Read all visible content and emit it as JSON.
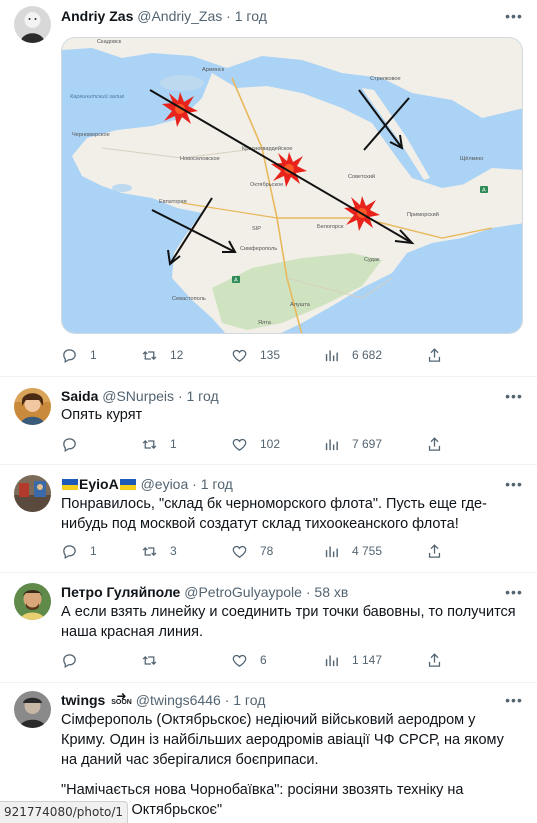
{
  "tweets": [
    {
      "name": "Andriy Zas",
      "handle": "@Andriy_Zas",
      "separator": "·",
      "time": "1 год",
      "text": "",
      "reply_count": "1",
      "retweet_count": "12",
      "like_count": "135",
      "view_count": "6 682"
    },
    {
      "name": "Saida",
      "handle": "@SNurpeis",
      "separator": "·",
      "time": "1 год",
      "text": "Опять курят",
      "reply_count": "",
      "retweet_count": "1",
      "like_count": "102",
      "view_count": "7 697"
    },
    {
      "name": "EyioA",
      "handle": "@eyioa",
      "separator": "·",
      "time": "1 год",
      "text": "Понравилось, \"склад бк черноморского флота\". Пусть еще где-нибудь под москвой создатут склад тихоокеанского флота!",
      "reply_count": "1",
      "retweet_count": "3",
      "like_count": "78",
      "view_count": "4 755"
    },
    {
      "name": "Петро Гуляйполе",
      "handle": "@PetroGulyaypole",
      "separator": "·",
      "time": "58 хв",
      "text": "А если взять линейку и соединить три точки бавовны, то получится наша красная линия.",
      "reply_count": "",
      "retweet_count": "",
      "like_count": "6",
      "view_count": "1 147"
    },
    {
      "name": "twings",
      "handle": "@twings6446",
      "separator": "·",
      "time": "1 год",
      "name_badge": "SOON",
      "text": "Сімферополь (Октябрьскоє) недіючий військовий аеродром у Криму. Один із найбільших аеродромів авіації ЧФ СРСР, на якому на даний час зберігалися боєприпаси.",
      "text2": "\"Намічається нова Чорнобаївка\": росіяни звозять техніку на аеродром Октябрьскоє\""
    }
  ],
  "map": {
    "labels": {
      "skadovsk": "Скадовск",
      "armyansk": "Армянск",
      "strelkovoe": "Стрелковое",
      "karkinit": "Каркинитский залив",
      "chernomorskoe": "Черноморское",
      "krasnogvardeyskoe": "Красногвардейское",
      "novoselovskoe": "Новоселовское",
      "oktyabrskoe": "Октябрьское",
      "sovetskiy": "Советский",
      "evpatoria": "Евпатория",
      "simferopol": "Симферополь",
      "belogorsk": "Белогорск",
      "primorskiy": "Приморский",
      "sudak": "Судак",
      "sevastopol": "Севастополь",
      "alushta": "Алушта",
      "yalta": "Ялта",
      "schelkino": "Щёлкино",
      "sip": "SIP"
    },
    "road_badges": [
      "A",
      "A"
    ],
    "colors": {
      "sea": "#aad3f5",
      "land": "#f2efe9",
      "mountain": "#cfe3c0",
      "explosion_outer": "#e8231b",
      "explosion_inner": "#ff5a2a",
      "line": "#111111"
    }
  },
  "url_bar": "921774080/photo/1"
}
